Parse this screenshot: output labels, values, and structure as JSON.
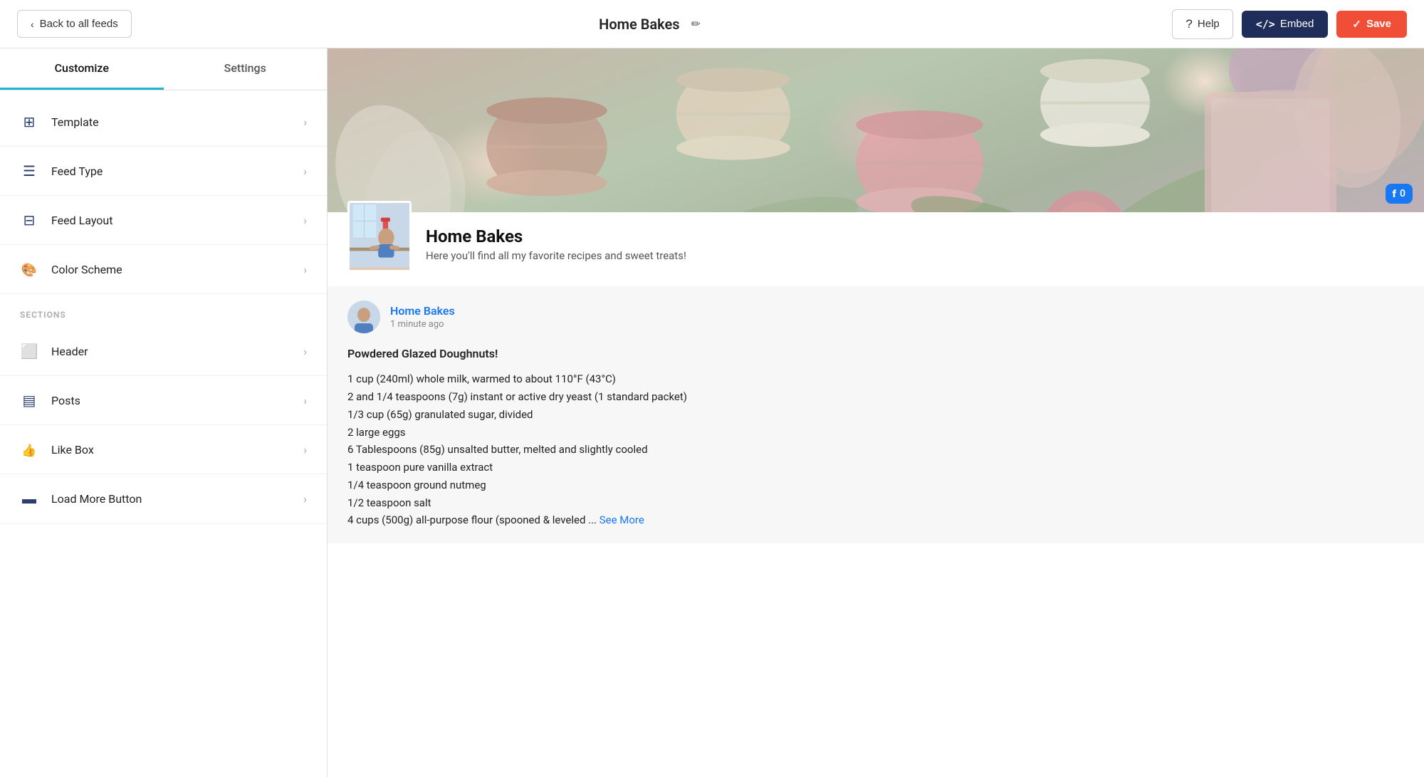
{
  "topbar": {
    "back_label": "Back to all feeds",
    "feed_title": "Home Bakes",
    "edit_icon": "✏",
    "help_label": "Help",
    "embed_label": "Embed",
    "save_label": "Save"
  },
  "sidebar": {
    "tab_customize": "Customize",
    "tab_settings": "Settings",
    "menu_items": [
      {
        "id": "template",
        "label": "Template",
        "icon": "template"
      },
      {
        "id": "feed-type",
        "label": "Feed Type",
        "icon": "feedtype"
      },
      {
        "id": "feed-layout",
        "label": "Feed Layout",
        "icon": "feedlayout"
      },
      {
        "id": "color-scheme",
        "label": "Color Scheme",
        "icon": "colorscheme"
      }
    ],
    "sections_label": "SECTIONS",
    "sections_items": [
      {
        "id": "header",
        "label": "Header",
        "icon": "header"
      },
      {
        "id": "posts",
        "label": "Posts",
        "icon": "posts"
      },
      {
        "id": "like-box",
        "label": "Like Box",
        "icon": "likebox"
      },
      {
        "id": "load-more",
        "label": "Load More Button",
        "icon": "loadmore"
      }
    ]
  },
  "preview": {
    "fb_badge_count": "0",
    "profile_name": "Home Bakes",
    "profile_desc": "Here you'll find all my favorite recipes and sweet treats!",
    "post": {
      "author": "Home Bakes",
      "time": "1 minute ago",
      "title": "Powdered Glazed Doughnuts!",
      "lines": [
        "1 cup (240ml) whole milk, warmed to about 110°F (43°C)",
        "2 and 1/4 teaspoons (7g) instant or active dry yeast (1 standard packet)",
        "1/3 cup (65g) granulated sugar, divided",
        "2 large eggs",
        "6 Tablespoons (85g) unsalted butter, melted and slightly cooled",
        "1 teaspoon pure vanilla extract",
        "1/4 teaspoon ground nutmeg",
        "1/2 teaspoon salt",
        "4 cups (500g) all-purpose flour (spooned & leveled ..."
      ],
      "see_more": "See More"
    }
  }
}
